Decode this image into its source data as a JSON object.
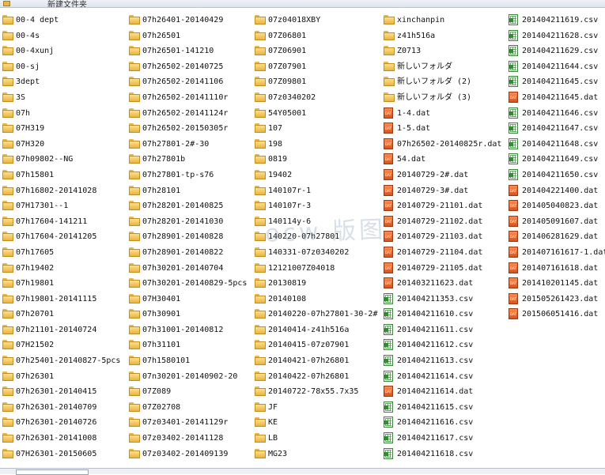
{
  "toolbar": {
    "new_folder_label": "新建文件夹"
  },
  "watermark": "ocw 版图",
  "columns": [
    [
      {
        "name": "00-4 dept",
        "type": "folder"
      },
      {
        "name": "00-4s",
        "type": "folder"
      },
      {
        "name": "00-4xunj",
        "type": "folder"
      },
      {
        "name": "00-sj",
        "type": "folder"
      },
      {
        "name": "3dept",
        "type": "folder"
      },
      {
        "name": "3S",
        "type": "folder"
      },
      {
        "name": "07h",
        "type": "folder"
      },
      {
        "name": "07H319",
        "type": "folder"
      },
      {
        "name": "07H320",
        "type": "folder"
      },
      {
        "name": "07h09802--NG",
        "type": "folder"
      },
      {
        "name": "07h15801",
        "type": "folder"
      },
      {
        "name": "07h16802-20141028",
        "type": "folder"
      },
      {
        "name": "07H17301--1",
        "type": "folder"
      },
      {
        "name": "07h17604-141211",
        "type": "folder"
      },
      {
        "name": "07h17604-20141205",
        "type": "folder"
      },
      {
        "name": "07h17605",
        "type": "folder"
      },
      {
        "name": "07h19402",
        "type": "folder"
      },
      {
        "name": "07h19801",
        "type": "folder"
      },
      {
        "name": "07h19801-20141115",
        "type": "folder"
      },
      {
        "name": "07h20701",
        "type": "folder"
      },
      {
        "name": "07h21101-20140724",
        "type": "folder"
      },
      {
        "name": "07H21502",
        "type": "folder"
      },
      {
        "name": "07h25401-20140827-5pcs",
        "type": "folder"
      },
      {
        "name": "07h26301",
        "type": "folder"
      },
      {
        "name": "07h26301-20140415",
        "type": "folder"
      },
      {
        "name": "07h26301-20140709",
        "type": "folder"
      },
      {
        "name": "07h26301-20140726",
        "type": "folder"
      },
      {
        "name": "07h26301-20141008",
        "type": "folder"
      },
      {
        "name": "07H26301-20150605",
        "type": "folder"
      }
    ],
    [
      {
        "name": "07h26401-20140429",
        "type": "folder"
      },
      {
        "name": "07h26501",
        "type": "folder"
      },
      {
        "name": "07h26501-141210",
        "type": "folder"
      },
      {
        "name": "07h26502-20140725",
        "type": "folder"
      },
      {
        "name": "07h26502-20141106",
        "type": "folder"
      },
      {
        "name": "07h26502-20141110r",
        "type": "folder"
      },
      {
        "name": "07h26502-20141124r",
        "type": "folder"
      },
      {
        "name": "07h26502-20150305r",
        "type": "folder"
      },
      {
        "name": "07h27801-2#-30",
        "type": "folder"
      },
      {
        "name": "07h27801b",
        "type": "folder"
      },
      {
        "name": "07h27801-tp-s76",
        "type": "folder"
      },
      {
        "name": "07h28101",
        "type": "folder"
      },
      {
        "name": "07h28201-20140825",
        "type": "folder"
      },
      {
        "name": "07h28201-20141030",
        "type": "folder"
      },
      {
        "name": "07h28901-20140828",
        "type": "folder"
      },
      {
        "name": "07h28901-20140822",
        "type": "folder"
      },
      {
        "name": "07h30201-20140704",
        "type": "folder"
      },
      {
        "name": "07h30201-20140829-5pcs",
        "type": "folder"
      },
      {
        "name": "07H30401",
        "type": "folder"
      },
      {
        "name": "07h30901",
        "type": "folder"
      },
      {
        "name": "07h31001-20140812",
        "type": "folder"
      },
      {
        "name": "07h31101",
        "type": "folder"
      },
      {
        "name": "07h1580101",
        "type": "folder"
      },
      {
        "name": "07n30201-20140902-20",
        "type": "folder"
      },
      {
        "name": "07Z089",
        "type": "folder"
      },
      {
        "name": "07Z02708",
        "type": "folder"
      },
      {
        "name": "07z03401-20141129r",
        "type": "folder"
      },
      {
        "name": "07z03402-20141128",
        "type": "folder"
      },
      {
        "name": "07z03402-201409139",
        "type": "folder"
      }
    ],
    [
      {
        "name": "07z04018XBY",
        "type": "folder"
      },
      {
        "name": "07Z06801",
        "type": "folder"
      },
      {
        "name": "07Z06901",
        "type": "folder"
      },
      {
        "name": "07Z07901",
        "type": "folder"
      },
      {
        "name": "07Z09801",
        "type": "folder"
      },
      {
        "name": "07z0340202",
        "type": "folder"
      },
      {
        "name": "54Y05001",
        "type": "folder"
      },
      {
        "name": "107",
        "type": "folder"
      },
      {
        "name": "198",
        "type": "folder"
      },
      {
        "name": "0819",
        "type": "folder"
      },
      {
        "name": "19402",
        "type": "folder"
      },
      {
        "name": "140107r-1",
        "type": "folder"
      },
      {
        "name": "140107r-3",
        "type": "folder"
      },
      {
        "name": "140114y-6",
        "type": "folder"
      },
      {
        "name": "140220-07h27801",
        "type": "folder"
      },
      {
        "name": "140331-07z0340202",
        "type": "folder"
      },
      {
        "name": "12121007Z04018",
        "type": "folder"
      },
      {
        "name": "20130819",
        "type": "folder"
      },
      {
        "name": "20140108",
        "type": "folder"
      },
      {
        "name": "20140220-07h27801-30-2#",
        "type": "folder"
      },
      {
        "name": "20140414-z41h516a",
        "type": "folder"
      },
      {
        "name": "20140415-07z07901",
        "type": "folder"
      },
      {
        "name": "20140421-07h26801",
        "type": "folder"
      },
      {
        "name": "20140422-07h26801",
        "type": "folder"
      },
      {
        "name": "20140722-78x55.7x35",
        "type": "folder"
      },
      {
        "name": "JF",
        "type": "folder"
      },
      {
        "name": "KE",
        "type": "folder"
      },
      {
        "name": "LB",
        "type": "folder"
      },
      {
        "name": "MG23",
        "type": "folder"
      }
    ],
    [
      {
        "name": "xinchanpin",
        "type": "folder"
      },
      {
        "name": "z41h516a",
        "type": "folder"
      },
      {
        "name": "Z0713",
        "type": "folder"
      },
      {
        "name": "新しいフォルダ",
        "type": "folder"
      },
      {
        "name": "新しいフォルダ (2)",
        "type": "folder"
      },
      {
        "name": "新しいフォルダ (3)",
        "type": "folder"
      },
      {
        "name": "1-4.dat",
        "type": "dat"
      },
      {
        "name": "1-5.dat",
        "type": "dat"
      },
      {
        "name": "07h26502-20140825r.dat",
        "type": "dat"
      },
      {
        "name": "54.dat",
        "type": "dat"
      },
      {
        "name": "20140729-2#.dat",
        "type": "dat"
      },
      {
        "name": "20140729-3#.dat",
        "type": "dat"
      },
      {
        "name": "20140729-21101.dat",
        "type": "dat"
      },
      {
        "name": "20140729-21102.dat",
        "type": "dat"
      },
      {
        "name": "20140729-21103.dat",
        "type": "dat"
      },
      {
        "name": "20140729-21104.dat",
        "type": "dat"
      },
      {
        "name": "20140729-21105.dat",
        "type": "dat"
      },
      {
        "name": "201403211623.dat",
        "type": "dat"
      },
      {
        "name": "201404211353.csv",
        "type": "csv"
      },
      {
        "name": "201404211610.csv",
        "type": "csv"
      },
      {
        "name": "201404211611.csv",
        "type": "csv"
      },
      {
        "name": "201404211612.csv",
        "type": "csv"
      },
      {
        "name": "201404211613.csv",
        "type": "csv"
      },
      {
        "name": "201404211614.csv",
        "type": "csv"
      },
      {
        "name": "201404211614.dat",
        "type": "dat"
      },
      {
        "name": "201404211615.csv",
        "type": "csv"
      },
      {
        "name": "201404211616.csv",
        "type": "csv"
      },
      {
        "name": "201404211617.csv",
        "type": "csv"
      },
      {
        "name": "201404211618.csv",
        "type": "csv"
      }
    ],
    [
      {
        "name": "201404211619.csv",
        "type": "csv"
      },
      {
        "name": "201404211628.csv",
        "type": "csv"
      },
      {
        "name": "201404211629.csv",
        "type": "csv"
      },
      {
        "name": "201404211644.csv",
        "type": "csv"
      },
      {
        "name": "201404211645.csv",
        "type": "csv"
      },
      {
        "name": "201404211645.dat",
        "type": "dat"
      },
      {
        "name": "201404211646.csv",
        "type": "csv"
      },
      {
        "name": "201404211647.csv",
        "type": "csv"
      },
      {
        "name": "201404211648.csv",
        "type": "csv"
      },
      {
        "name": "201404211649.csv",
        "type": "csv"
      },
      {
        "name": "201404211650.csv",
        "type": "csv"
      },
      {
        "name": "201404221400.dat",
        "type": "dat"
      },
      {
        "name": "201405040823.dat",
        "type": "dat"
      },
      {
        "name": "201405091607.dat",
        "type": "dat"
      },
      {
        "name": "201406281629.dat",
        "type": "dat"
      },
      {
        "name": "201407161617-1.dat",
        "type": "dat"
      },
      {
        "name": "201407161618.dat",
        "type": "dat"
      },
      {
        "name": "201410201145.dat",
        "type": "dat"
      },
      {
        "name": "201505261423.dat",
        "type": "dat"
      },
      {
        "name": "201506051416.dat",
        "type": "dat"
      }
    ]
  ]
}
